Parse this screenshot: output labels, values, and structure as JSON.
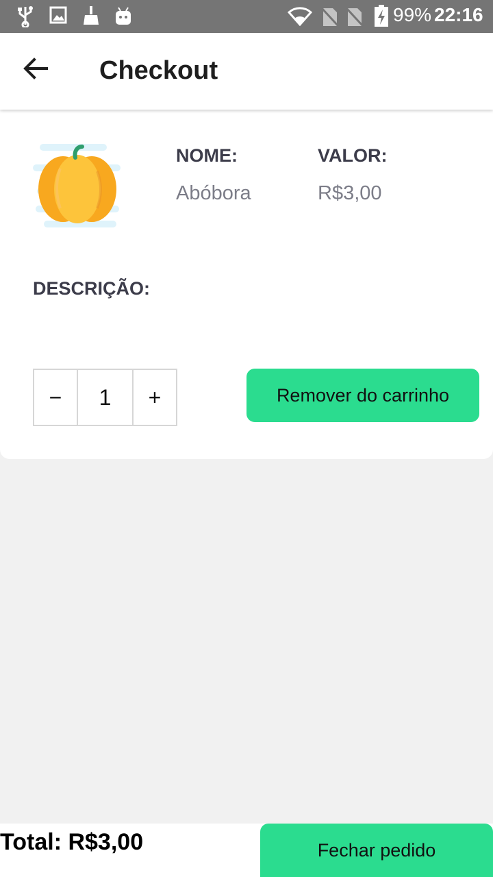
{
  "status_bar": {
    "battery": "99%",
    "time": "22:16",
    "left_icons": [
      "usb-icon",
      "image-icon",
      "broom-icon",
      "android-icon"
    ],
    "right_icons": [
      "wifi-icon",
      "no-sim-icon",
      "no-sim-icon",
      "battery-charging-icon"
    ]
  },
  "app_bar": {
    "title": "Checkout",
    "back_icon": "arrow-left-icon"
  },
  "cart_item": {
    "image_icon": "pumpkin-icon",
    "name_label": "NOME:",
    "name_value": "Abóbora",
    "price_label": "VALOR:",
    "price_value": "R$3,00",
    "description_label": "DESCRIÇÃO:",
    "quantity": "1",
    "decrement_label": "−",
    "increment_label": "+",
    "remove_button": "Remover do carrinho"
  },
  "footer": {
    "total": "Total: R$3,00",
    "checkout_button": "Fechar pedido"
  },
  "colors": {
    "accent": "#2bdc8f",
    "status_bar": "#757575",
    "background": "#f1f1f1"
  }
}
